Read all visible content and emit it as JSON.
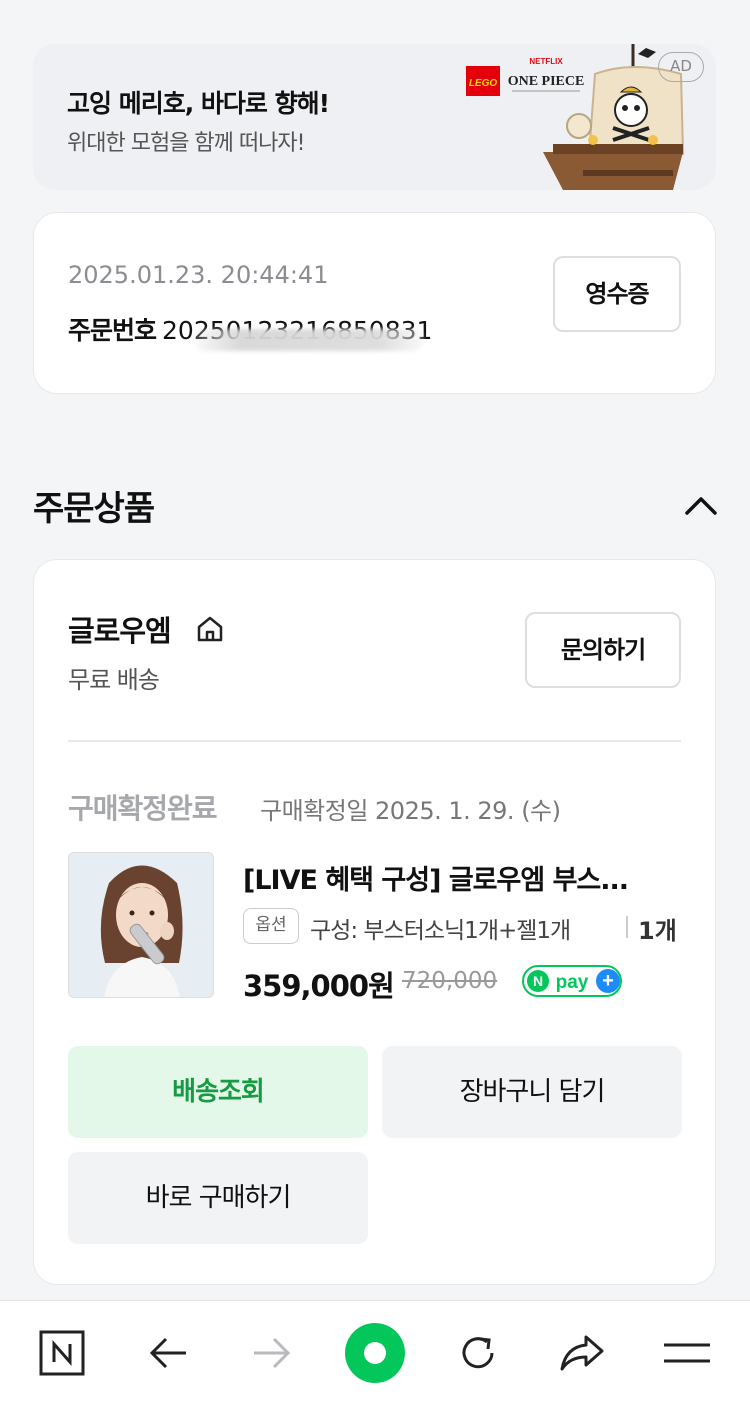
{
  "ad": {
    "title": "고잉 메리호, 바다로 향해!",
    "subtitle": "위대한 모험을 함께 떠나자!",
    "badge": "AD",
    "brand_lego": "LEGO",
    "brand_netflix": "NETFLIX",
    "brand_onepiece": "ONE PIECE"
  },
  "order": {
    "datetime": "2025.01.23. 20:44:41",
    "number_label": "주문번호",
    "number_value": "20250123216850831",
    "receipt_button": "영수증"
  },
  "section": {
    "title": "주문상품",
    "collapse_icon": "chevron-up-icon"
  },
  "store": {
    "name": "글로우엠",
    "home_icon": "home-icon",
    "shipping": "무료 배송",
    "inquiry_button": "문의하기"
  },
  "product": {
    "status": "구매확정완료",
    "confirm_date": "구매확정일 2025. 1. 29. (수)",
    "name": "[LIVE 혜택 구성] 글로우엠 부스...",
    "option_badge": "옵션",
    "option_text": "구성: 부스터소닉1개+젤1개",
    "quantity": "1개",
    "price": "359,000원",
    "original_price": "720,000",
    "npay_label": "N pay +"
  },
  "actions": {
    "track": "배송조회",
    "cart": "장바구니 담기",
    "buy_now": "바로 구매하기"
  },
  "bottom_nav": [
    "naver-home-icon",
    "back-arrow-icon",
    "forward-arrow-icon",
    "green-dot-icon",
    "refresh-icon",
    "share-icon",
    "menu-icon"
  ],
  "colors": {
    "accent_green": "#179a43",
    "green_bg": "#e3f8e8",
    "npay_green": "#03c75a",
    "npay_blue": "#1d8cf8"
  }
}
